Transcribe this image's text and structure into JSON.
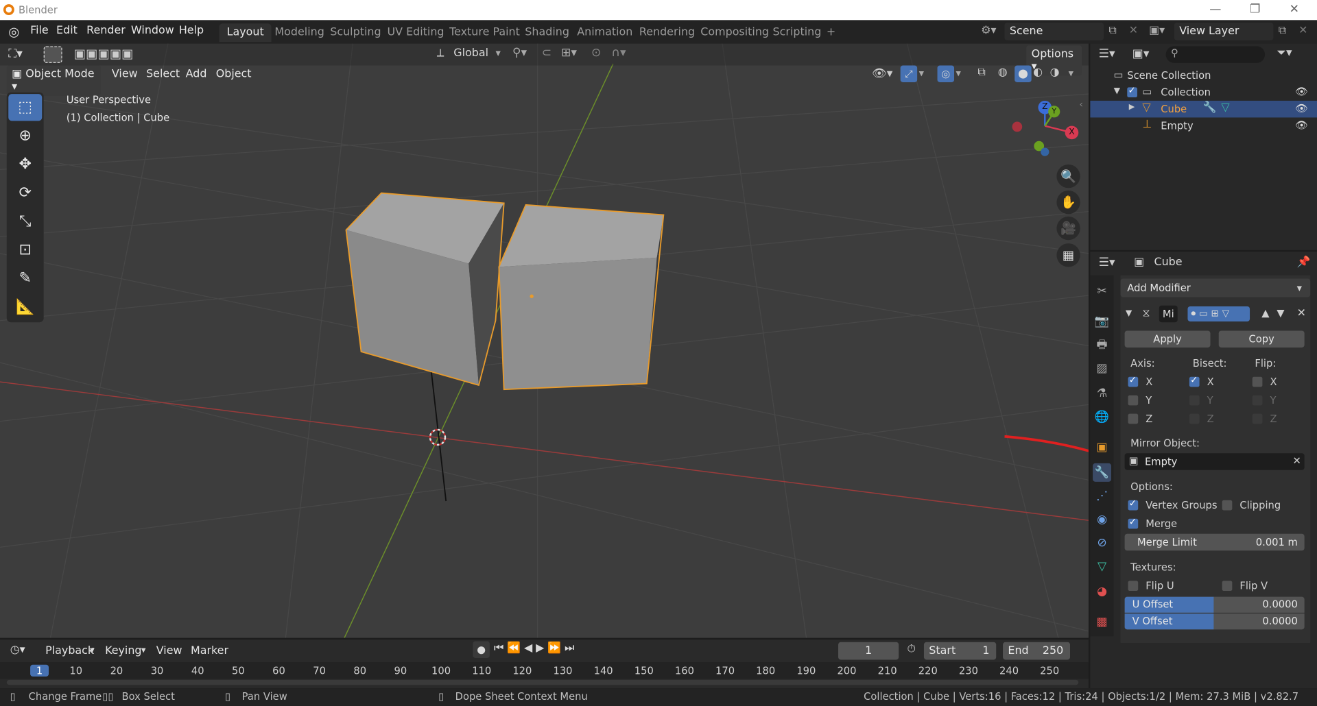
{
  "window": {
    "title": "Blender",
    "controls": [
      "—",
      "❐",
      "✕"
    ]
  },
  "topbar": {
    "menus": [
      "File",
      "Edit",
      "Render",
      "Window",
      "Help"
    ],
    "workspaces": [
      "Layout",
      "Modeling",
      "Sculpting",
      "UV Editing",
      "Texture Paint",
      "Shading",
      "Animation",
      "Rendering",
      "Compositing",
      "Scripting",
      "+"
    ],
    "active_workspace": "Layout",
    "scene": "Scene",
    "view_layer": "View Layer"
  },
  "viewport": {
    "transform_orientation": "Global",
    "options": "Options",
    "mode": "Object Mode",
    "menus": [
      "View",
      "Select",
      "Add",
      "Object"
    ],
    "perspective": "User Perspective",
    "collection_info": "(1) Collection | Cube",
    "gizmo": {
      "x": "X",
      "y": "Y",
      "z": "Z"
    }
  },
  "timeline": {
    "menus": [
      "Playback",
      "Keying",
      "View",
      "Marker"
    ],
    "current_frame": "1",
    "start_label": "Start",
    "start": "1",
    "end_label": "End",
    "end": "250",
    "ruler": [
      "1",
      "10",
      "20",
      "30",
      "40",
      "50",
      "60",
      "70",
      "80",
      "90",
      "100",
      "110",
      "120",
      "130",
      "140",
      "150",
      "160",
      "170",
      "180",
      "190",
      "200",
      "210",
      "220",
      "230",
      "240",
      "250"
    ]
  },
  "status": {
    "change_frame": "Change Frame",
    "box_select": "Box Select",
    "pan_view": "Pan View",
    "context_menu": "Dope Sheet Context Menu",
    "stats": "Collection | Cube | Verts:16 | Faces:12 | Tris:24 | Objects:1/2 | Mem: 27.3 MiB | v2.82.7"
  },
  "outliner": {
    "scene_collection": "Scene Collection",
    "collection": "Collection",
    "cube": "Cube",
    "empty": "Empty"
  },
  "properties": {
    "object": "Cube",
    "add_modifier": "Add Modifier",
    "modifier_name": "Mi",
    "apply": "Apply",
    "copy": "Copy",
    "axis": "Axis:",
    "bisect": "Bisect:",
    "flip": "Flip:",
    "x": "X",
    "y": "Y",
    "z": "Z",
    "mirror_object": "Mirror Object:",
    "mirror_value": "Empty",
    "options": "Options:",
    "vertex_groups": "Vertex Groups",
    "clipping": "Clipping",
    "merge": "Merge",
    "merge_limit": "Merge Limit",
    "merge_limit_value": "0.001 m",
    "textures": "Textures:",
    "flip_u": "Flip U",
    "flip_v": "Flip V",
    "u_offset": "U Offset",
    "u_offset_value": "0.0000",
    "v_offset": "V Offset",
    "v_offset_value": "0.0000"
  },
  "colors": {
    "accent": "#4772b3",
    "selection": "#e89b2c",
    "annotation": "#e02020"
  }
}
